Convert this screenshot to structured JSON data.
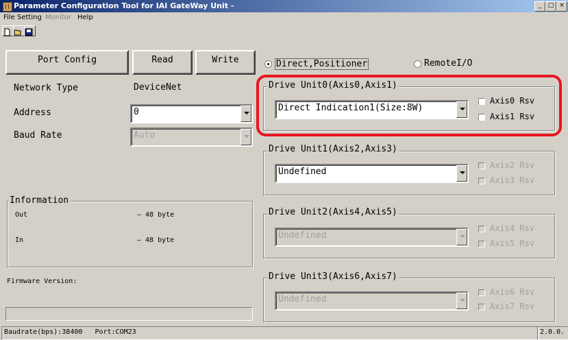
{
  "window": {
    "title": "Parameter Configuration Tool for IAI GateWay Unit -"
  },
  "window_controls": [
    "_",
    "□",
    "×"
  ],
  "menu": [
    {
      "label": "File",
      "enabled": true
    },
    {
      "label": "Setting",
      "enabled": true
    },
    {
      "label": "Monitor",
      "enabled": false
    },
    {
      "label": "Help",
      "enabled": true
    }
  ],
  "toolbar": [
    "new-icon",
    "open-icon",
    "save-icon"
  ],
  "buttons": {
    "port_config": "Port Config",
    "read": "Read",
    "write": "Write"
  },
  "settings": {
    "network_type_label": "Network Type",
    "network_type_value": "DeviceNet",
    "address_label": "Address",
    "address_value": "0",
    "baud_rate_label": "Baud Rate",
    "baud_rate_value": "Auto"
  },
  "information": {
    "title": "Information",
    "out_label": "Out",
    "out_value": "– 48 byte",
    "in_label": "In",
    "in_value": "– 48 byte"
  },
  "firmware": {
    "label": "Firmware Version:",
    "value": ""
  },
  "mode": {
    "direct_label": "Direct,Positioner",
    "direct_selected": true,
    "remote_label": "RemoteI/O",
    "remote_selected": false
  },
  "drive_units": [
    {
      "title": "Drive Unit0(Axis0,Axis1)",
      "selection": "Direct Indication1(Size:8W)",
      "enabled": true,
      "rsv_a": "Axis0 Rsv",
      "rsv_b": "Axis1 Rsv"
    },
    {
      "title": "Drive Unit1(Axis2,Axis3)",
      "selection": "Undefined",
      "enabled": true,
      "rsv_a": "Axis2 Rsv",
      "rsv_b": "Axis3 Rsv"
    },
    {
      "title": "Drive Unit2(Axis4,Axis5)",
      "selection": "Undefined",
      "enabled": false,
      "rsv_a": "Axis4 Rsv",
      "rsv_b": "Axis5 Rsv"
    },
    {
      "title": "Drive Unit3(Axis6,Axis7)",
      "selection": "Undefined",
      "enabled": false,
      "rsv_a": "Axis6 Rsv",
      "rsv_b": "Axis7 Rsv"
    }
  ],
  "statusbar": {
    "baudrate": "Baudrate(bps):38400",
    "port": "Port:COM23",
    "version": "2.0.0."
  },
  "colors": {
    "highlight": "#e8141e",
    "face": "#d4d0c8",
    "titlebar": "#0a246a"
  }
}
